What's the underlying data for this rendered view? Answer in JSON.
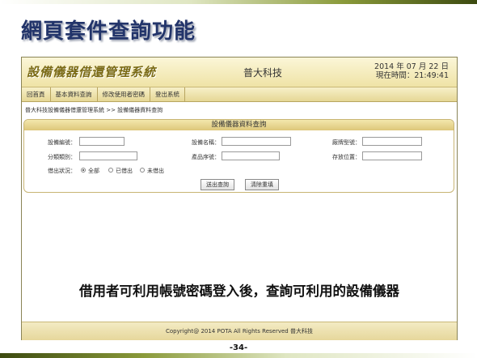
{
  "slide": {
    "title": "網頁套件查詢功能",
    "page_number": "-34-",
    "caption": "借用者可利用帳號密碼登入後，查詢可利用的設備儀器"
  },
  "app": {
    "logo_text": "設備儀器借還管理系統",
    "company": "普大科技",
    "date": "2014 年 07 月 22 日",
    "time": "現在時間：21:49:41"
  },
  "menu": [
    "回首頁",
    "基本資料查詢",
    "修改使用者密碼",
    "登出系統"
  ],
  "breadcrumb": "普大科技設備儀器借還管理系統 >> 設備儀器資料查詢",
  "form": {
    "title": "設備儀器資料查詢",
    "labels": {
      "device_id": "設備編號：",
      "device_name": "設備名稱：",
      "brand_model": "廠牌型號：",
      "category": "分類類別：",
      "serial_no": "產品序號：",
      "location": "存放位置：",
      "loan_status": "借出狀況："
    },
    "status_options": [
      "全部",
      "已借出",
      "未借出"
    ],
    "selected_status": "全部",
    "submit_label": "送出查詢",
    "reset_label": "清除重填"
  },
  "footer": "Copyright@ 2014 POTA All Rights Reserved 普大科技",
  "colors": {
    "title": "#22346a",
    "header_gold": "#efe3a6",
    "border": "#8a8456"
  }
}
